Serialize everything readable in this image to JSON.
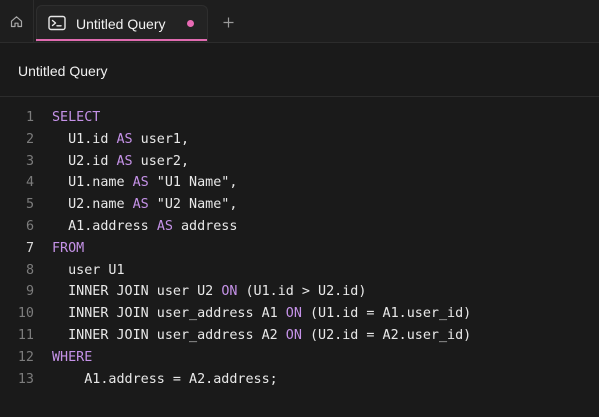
{
  "tabs": [
    {
      "label": "Untitled Query",
      "unsaved": true,
      "active": true
    }
  ],
  "header": {
    "title": "Untitled Query"
  },
  "icons": {
    "home": "home-icon",
    "tab": "terminal-icon",
    "add": "plus-icon"
  },
  "colors": {
    "keyword": "#c592e8",
    "accent": "#e06bb0",
    "unsaved_dot": "#e86ab4"
  },
  "editor": {
    "active_line": 7,
    "lines": [
      {
        "n": "1",
        "tokens": [
          {
            "t": "SELECT",
            "k": "kw"
          }
        ]
      },
      {
        "n": "2",
        "tokens": [
          {
            "t": "  U1.id "
          },
          {
            "t": "AS",
            "k": "kw"
          },
          {
            "t": " user1,"
          }
        ]
      },
      {
        "n": "3",
        "tokens": [
          {
            "t": "  U2.id "
          },
          {
            "t": "AS",
            "k": "kw"
          },
          {
            "t": " user2,"
          }
        ]
      },
      {
        "n": "4",
        "tokens": [
          {
            "t": "  U1.name "
          },
          {
            "t": "AS",
            "k": "kw"
          },
          {
            "t": " \"U1 Name\","
          }
        ]
      },
      {
        "n": "5",
        "tokens": [
          {
            "t": "  U2.name "
          },
          {
            "t": "AS",
            "k": "kw"
          },
          {
            "t": " \"U2 Name\","
          }
        ]
      },
      {
        "n": "6",
        "tokens": [
          {
            "t": "  A1.address "
          },
          {
            "t": "AS",
            "k": "kw"
          },
          {
            "t": " address"
          }
        ]
      },
      {
        "n": "7",
        "tokens": [
          {
            "t": "FROM",
            "k": "kw"
          }
        ]
      },
      {
        "n": "8",
        "tokens": [
          {
            "t": "  user U1"
          }
        ]
      },
      {
        "n": "9",
        "tokens": [
          {
            "t": "  INNER JOIN user U2 "
          },
          {
            "t": "ON",
            "k": "kw"
          },
          {
            "t": " (U1.id > U2.id)"
          }
        ]
      },
      {
        "n": "10",
        "tokens": [
          {
            "t": "  INNER JOIN user_address A1 "
          },
          {
            "t": "ON",
            "k": "kw"
          },
          {
            "t": " (U1.id = A1.user_id)"
          }
        ]
      },
      {
        "n": "11",
        "tokens": [
          {
            "t": "  INNER JOIN user_address A2 "
          },
          {
            "t": "ON",
            "k": "kw"
          },
          {
            "t": " (U2.id = A2.user_id)"
          }
        ]
      },
      {
        "n": "12",
        "tokens": [
          {
            "t": "WHERE",
            "k": "kw"
          }
        ]
      },
      {
        "n": "13",
        "tokens": [
          {
            "t": "    A1.address = A2.address;"
          }
        ]
      }
    ]
  }
}
